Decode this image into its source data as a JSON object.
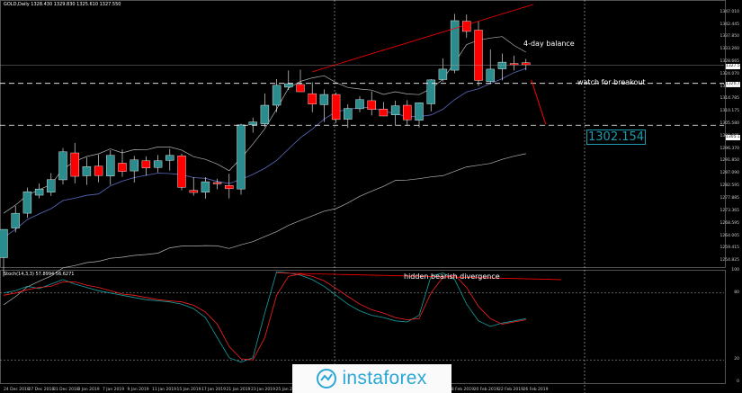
{
  "header": "GOLD,Daily 1328.430 1329.830 1325.610 1327.550",
  "sub_header": "Stoch(14,3,3) 57.8994 56.6271",
  "annotations": {
    "balance": "4-day balance",
    "watch": "watch for breakout",
    "divergence": "hidden bearish divergence",
    "target": "1302.154"
  },
  "logo": "instaforex",
  "price_boxes": {
    "current": "1327.550",
    "mid": "1320.720",
    "low": "1305.180"
  },
  "chart_data": {
    "type": "candlestick",
    "price_ticks": [
      "1347.010",
      "1342.445",
      "1337.850",
      "1333.260",
      "1328.665",
      "1324.070",
      "1319.155",
      "1314.785",
      "1310.175",
      "1305.580",
      "1300.985",
      "1296.370",
      "1291.850",
      "1287.090",
      "1282.595",
      "1277.885",
      "1273.365",
      "1268.595",
      "1264.005",
      "1259.415",
      "1254.825"
    ],
    "stoch_ticks": [
      "100",
      "80",
      "20",
      "0"
    ],
    "date_ticks": [
      "24 Dec 2018",
      "27 Dec 2018",
      "31 Dec 2018",
      "3 Jan 2019",
      "7 Jan 2019",
      "9 Jan 2019",
      "11 Jan 2019",
      "15 Jan 2019",
      "17 Jan 2019",
      "21 Jan 2019",
      "23 Jan 2019",
      "25 Jan 2019",
      "",
      "",
      "",
      "",
      "",
      "",
      "18 Feb 2019",
      "20 Feb 2019",
      "22 Feb 2019",
      "26 Feb 2019"
    ],
    "candles": [
      {
        "o": 1256.0,
        "h": 1264.4,
        "l": 1249.0,
        "c": 1266.5
      },
      {
        "o": 1267.0,
        "h": 1275.2,
        "l": 1265.4,
        "c": 1272.5
      },
      {
        "o": 1272.5,
        "h": 1282.0,
        "l": 1270.8,
        "c": 1280.5
      },
      {
        "o": 1279.2,
        "h": 1283.5,
        "l": 1278.0,
        "c": 1281.5
      },
      {
        "o": 1280.3,
        "h": 1287.4,
        "l": 1278.9,
        "c": 1285.0
      },
      {
        "o": 1284.9,
        "h": 1296.7,
        "l": 1283.2,
        "c": 1295.3
      },
      {
        "o": 1294.9,
        "h": 1298.6,
        "l": 1283.6,
        "c": 1286.2
      },
      {
        "o": 1286.4,
        "h": 1293.2,
        "l": 1283.0,
        "c": 1289.8
      },
      {
        "o": 1290.0,
        "h": 1294.3,
        "l": 1284.0,
        "c": 1286.5
      },
      {
        "o": 1286.3,
        "h": 1295.9,
        "l": 1283.0,
        "c": 1294.0
      },
      {
        "o": 1291.1,
        "h": 1296.2,
        "l": 1286.0,
        "c": 1288.0
      },
      {
        "o": 1288.2,
        "h": 1293.8,
        "l": 1283.9,
        "c": 1292.3
      },
      {
        "o": 1292.0,
        "h": 1293.6,
        "l": 1286.4,
        "c": 1289.3
      },
      {
        "o": 1289.5,
        "h": 1294.1,
        "l": 1287.7,
        "c": 1292.0
      },
      {
        "o": 1292.1,
        "h": 1296.4,
        "l": 1288.3,
        "c": 1294.0
      },
      {
        "o": 1293.8,
        "h": 1294.6,
        "l": 1281.0,
        "c": 1282.1
      },
      {
        "o": 1281.0,
        "h": 1285.9,
        "l": 1279.0,
        "c": 1280.2
      },
      {
        "o": 1280.3,
        "h": 1285.9,
        "l": 1277.9,
        "c": 1284.2
      },
      {
        "o": 1283.9,
        "h": 1285.3,
        "l": 1281.4,
        "c": 1283.4
      },
      {
        "o": 1282.8,
        "h": 1287.2,
        "l": 1278.0,
        "c": 1281.6
      },
      {
        "o": 1281.5,
        "h": 1305.7,
        "l": 1279.4,
        "c": 1305.3
      },
      {
        "o": 1305.3,
        "h": 1308.0,
        "l": 1302.4,
        "c": 1306.4
      },
      {
        "o": 1305.7,
        "h": 1317.0,
        "l": 1304.5,
        "c": 1312.6
      },
      {
        "o": 1312.6,
        "h": 1322.3,
        "l": 1310.0,
        "c": 1320.0
      },
      {
        "o": 1319.3,
        "h": 1325.5,
        "l": 1318.3,
        "c": 1320.6
      },
      {
        "o": 1320.3,
        "h": 1325.8,
        "l": 1318.5,
        "c": 1317.6
      },
      {
        "o": 1316.9,
        "h": 1321.1,
        "l": 1310.0,
        "c": 1313.0
      },
      {
        "o": 1312.8,
        "h": 1318.5,
        "l": 1306.4,
        "c": 1316.6
      },
      {
        "o": 1316.6,
        "h": 1317.3,
        "l": 1306.0,
        "c": 1307.3
      },
      {
        "o": 1307.4,
        "h": 1313.0,
        "l": 1304.2,
        "c": 1311.4
      },
      {
        "o": 1311.3,
        "h": 1316.0,
        "l": 1310.0,
        "c": 1314.7
      },
      {
        "o": 1314.3,
        "h": 1317.8,
        "l": 1308.8,
        "c": 1311.0
      },
      {
        "o": 1311.2,
        "h": 1313.8,
        "l": 1308.5,
        "c": 1308.6
      },
      {
        "o": 1309.0,
        "h": 1314.3,
        "l": 1305.0,
        "c": 1312.4
      },
      {
        "o": 1312.6,
        "h": 1314.5,
        "l": 1305.0,
        "c": 1307.2
      },
      {
        "o": 1307.0,
        "h": 1313.6,
        "l": 1304.3,
        "c": 1313.5
      },
      {
        "o": 1313.1,
        "h": 1322.3,
        "l": 1310.3,
        "c": 1322.0
      },
      {
        "o": 1322.1,
        "h": 1330.0,
        "l": 1321.4,
        "c": 1326.0
      },
      {
        "o": 1325.6,
        "h": 1346.5,
        "l": 1324.5,
        "c": 1344.0
      },
      {
        "o": 1343.8,
        "h": 1346.3,
        "l": 1337.7,
        "c": 1340.0
      },
      {
        "o": 1340.5,
        "h": 1343.8,
        "l": 1319.7,
        "c": 1321.8
      },
      {
        "o": 1321.4,
        "h": 1333.3,
        "l": 1320.5,
        "c": 1326.0
      },
      {
        "o": 1326.1,
        "h": 1331.8,
        "l": 1321.8,
        "c": 1328.6
      },
      {
        "o": 1328.1,
        "h": 1331.0,
        "l": 1325.5,
        "c": 1327.6
      },
      {
        "o": 1328.4,
        "h": 1329.8,
        "l": 1325.6,
        "c": 1327.6
      }
    ]
  },
  "colors": {
    "bull": "#2a8c8c",
    "bear": "#ff0000",
    "grid": "#ffffff",
    "ma_white": "#b4b4b4",
    "ma_blue": "#5c6bc0",
    "trendline": "#ff0000",
    "stoch_main": "#1aa0a0",
    "stoch_signal": "#ff2020",
    "target": "#1b9bb0"
  },
  "icons": [
    "instaforex-logo-icon"
  ]
}
